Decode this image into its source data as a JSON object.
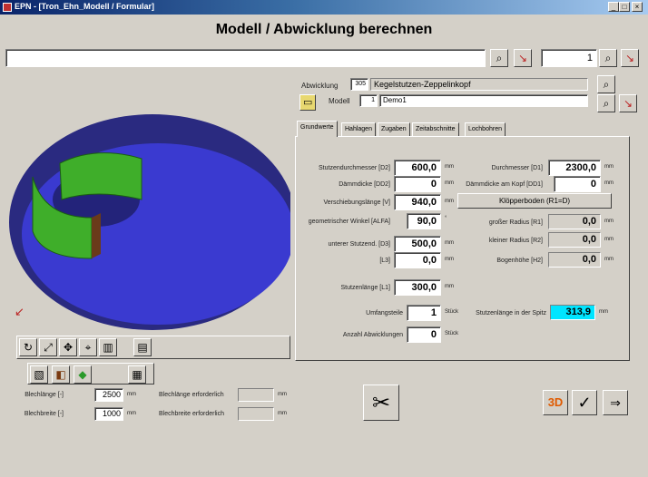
{
  "window": {
    "title": "EPN - [Tron_Ehn_Modell / Formular]",
    "min": "_",
    "max": "□",
    "close": "×"
  },
  "heading": "Modell / Abwicklung berechnen",
  "topbar": {
    "search_value": "",
    "counter_value": "1"
  },
  "abwicklung": {
    "label": "Abwicklung",
    "number": "305",
    "name": "Kegelstutzen-Zeppelinkopf",
    "model_label": "Modell",
    "model_number": "1",
    "model_name": "Demo1"
  },
  "tabs": [
    "Grundwerte",
    "Hahlagen",
    "Zugaben",
    "Zeitabschnitte",
    "Lochbohren"
  ],
  "left_fields": [
    {
      "label": "Stutzendurchmesser [D2]",
      "value": "600,0",
      "unit": "mm"
    },
    {
      "label": "Dämmdicke [DD2]",
      "value": "0",
      "unit": "mm"
    },
    {
      "label": "Verschiebungslänge [V]",
      "value": "940,0",
      "unit": "mm"
    },
    {
      "label": "geometrischer Winkel [ALFA]",
      "value": "90,0",
      "unit": "°"
    },
    {
      "label": "unterer Stutzend. [D3]",
      "value": "500,0",
      "unit": "mm"
    },
    {
      "label": "[L3]",
      "value": "0,0",
      "unit": "mm"
    },
    {
      "label": "Stutzenlänge [L1]",
      "value": "300,0",
      "unit": "mm"
    },
    {
      "label": "Umfangsteile",
      "value": "1",
      "unit": "Stück"
    },
    {
      "label": "Anzahl Abwicklungen",
      "value": "0",
      "unit": "Stück"
    }
  ],
  "right_fields": [
    {
      "label": "Durchmesser [D1]",
      "value": "2300,0",
      "unit": "mm"
    },
    {
      "label": "Dämmdicke am Kopf [DD1]",
      "value": "0",
      "unit": "mm"
    },
    {
      "label": "großer Radius [R1]",
      "value": "0,0",
      "unit": "mm"
    },
    {
      "label": "kleiner Radius [R2]",
      "value": "0,0",
      "unit": "mm"
    },
    {
      "label": "Bogenhöhe [H2]",
      "value": "0,0",
      "unit": "mm"
    },
    {
      "label": "Stutzenlänge in der Spitz",
      "value": "313,9",
      "unit": "mm"
    }
  ],
  "kloepper_button": "Klöpperboden (R1=D)",
  "blech": [
    {
      "label": "Blechlänge [-]",
      "value": "2500",
      "unit": "mm",
      "label2": "Blechlänge erforderlich",
      "value2": "",
      "unit2": "mm"
    },
    {
      "label": "Blechbreite [-]",
      "value": "1000",
      "unit": "mm",
      "label2": "Blechbreite erforderlich",
      "value2": "",
      "unit2": "mm"
    }
  ],
  "buttons": {
    "three_d": "3D",
    "ok": "✓",
    "exit": "⇒"
  },
  "colors": {
    "title_start": "#0a246a",
    "model_ellipse": "#3a3aa8",
    "model_cylinder": "#3fae2a",
    "highlight_field": "#00e5ff"
  }
}
